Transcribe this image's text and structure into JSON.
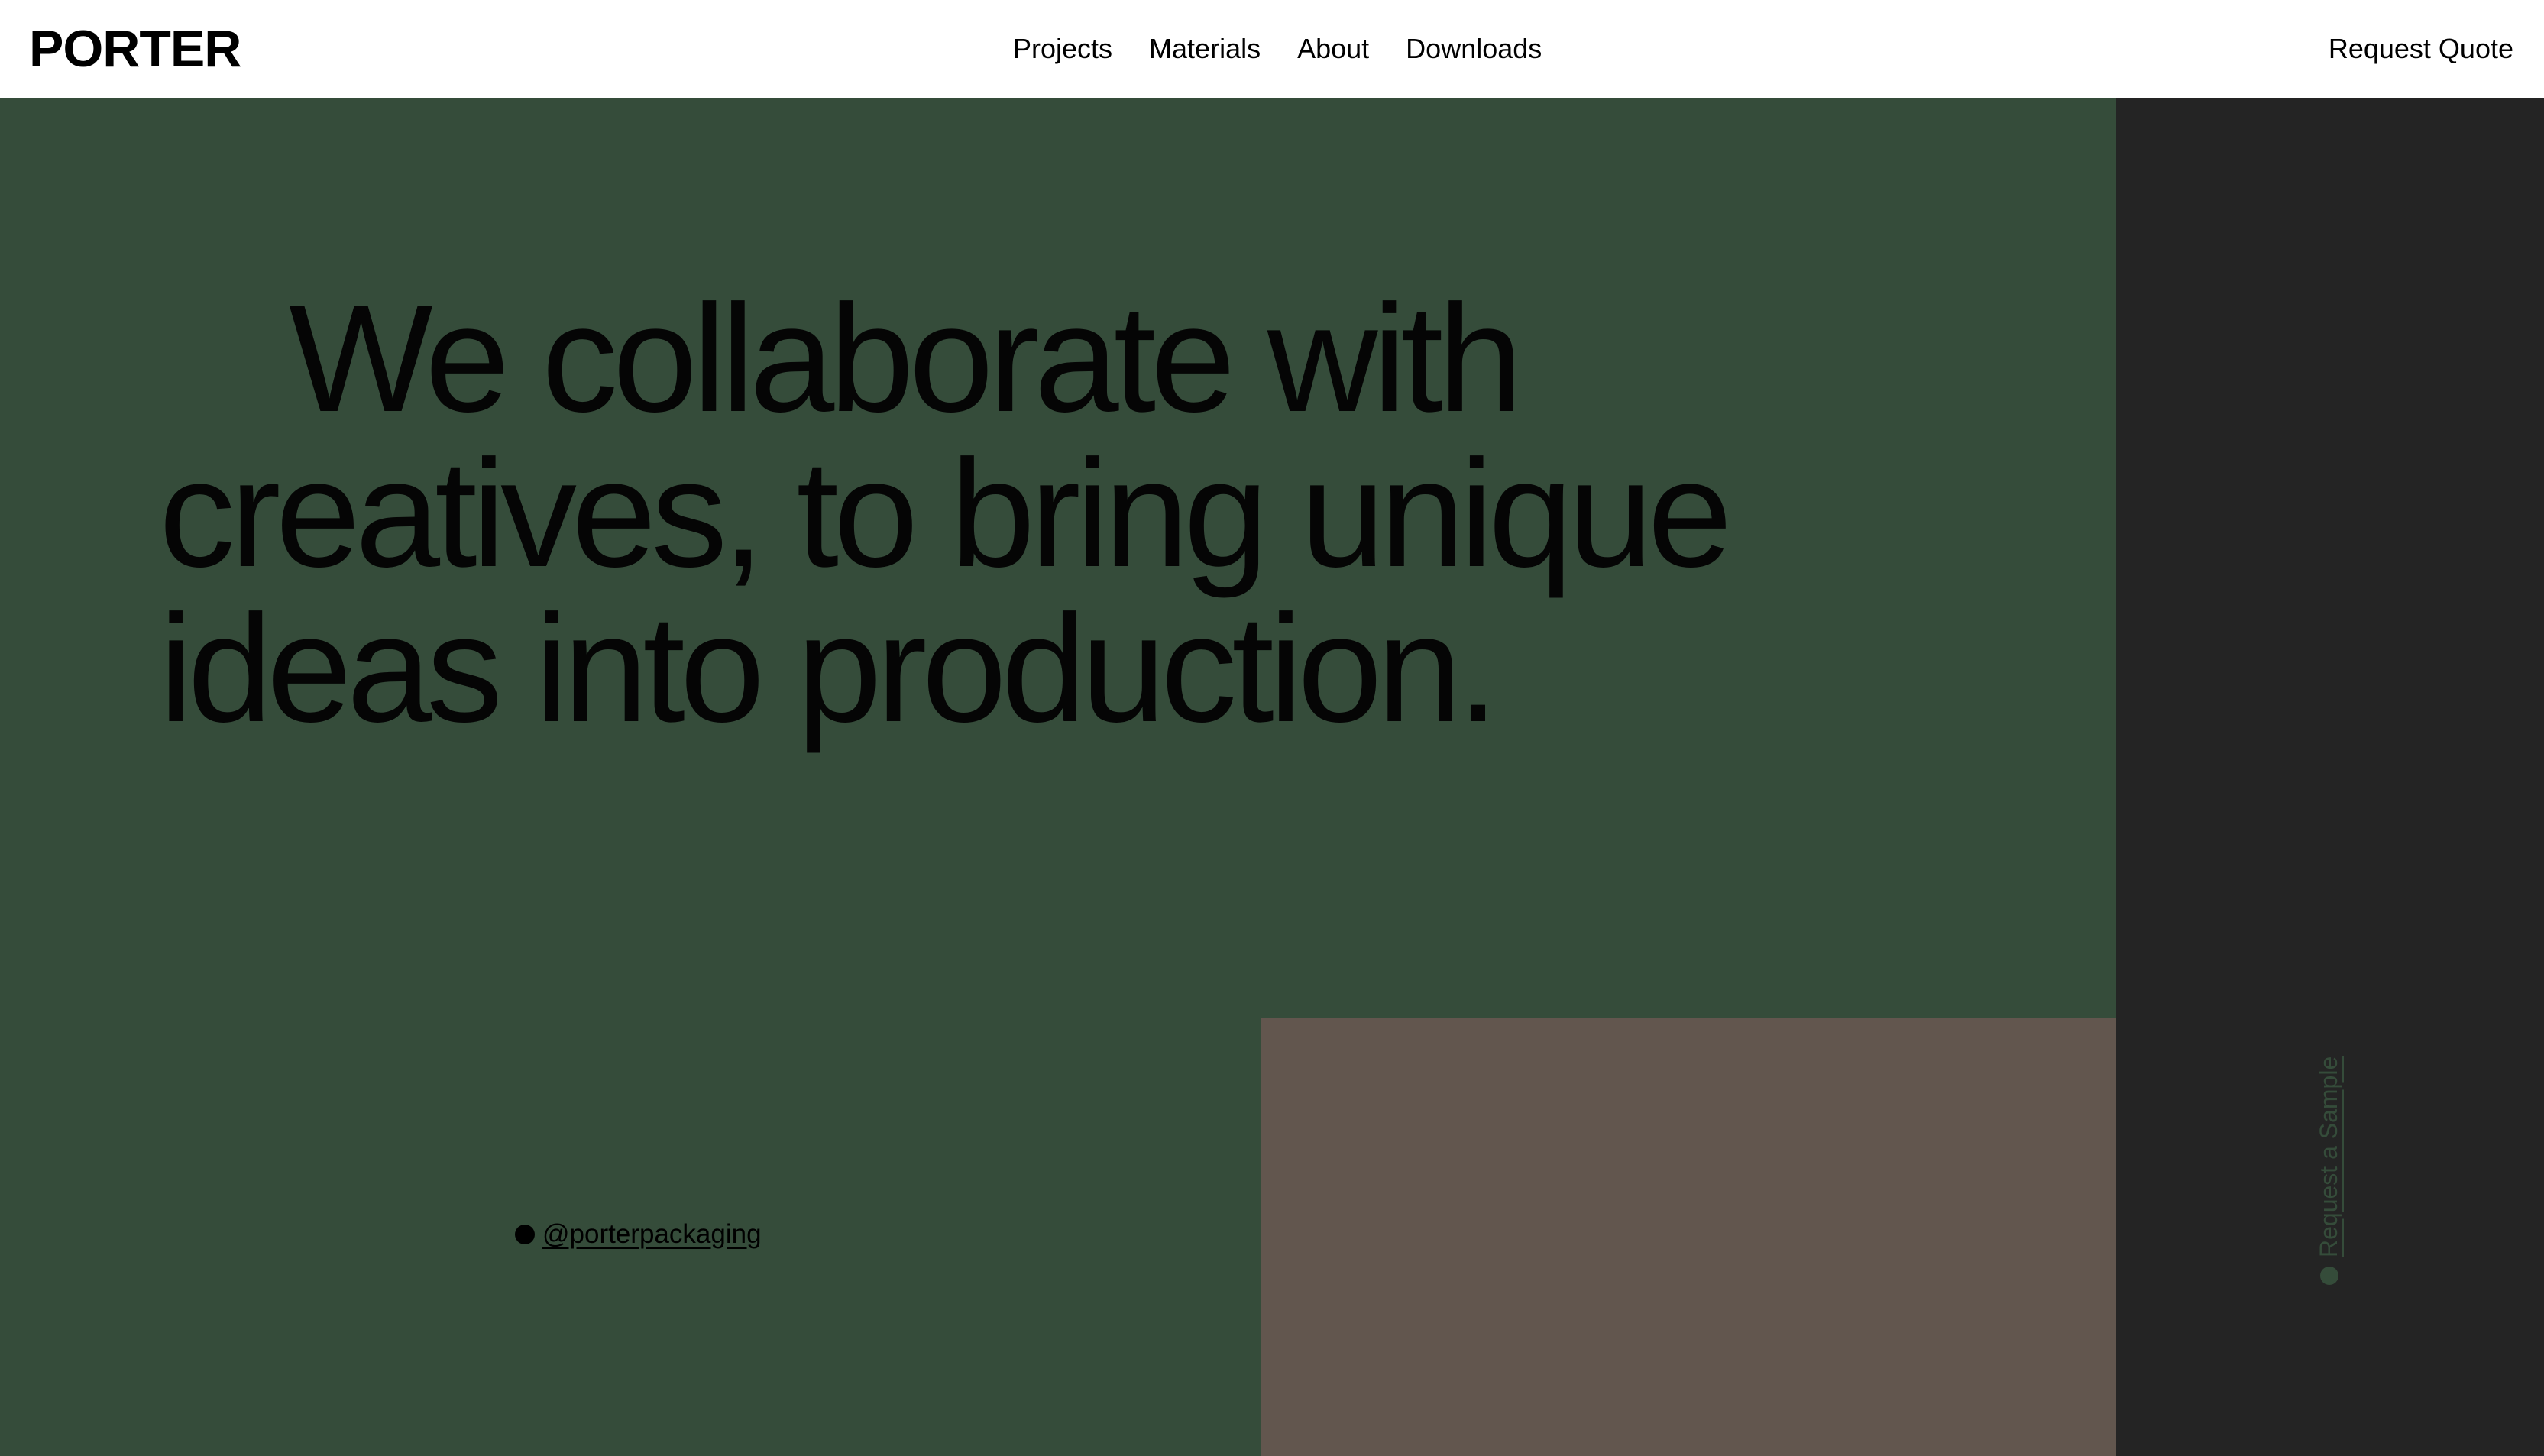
{
  "header": {
    "logo": "PORTER",
    "nav": [
      "Projects",
      "Materials",
      "About",
      "Downloads"
    ],
    "cta": "Request Quote"
  },
  "hero": {
    "headline": "We collaborate with creatives, to bring unique ideas into production.",
    "social_handle": "@porterpackaging"
  },
  "side_panel": {
    "link": "Request a Sample"
  },
  "colors": {
    "hero_background": "#354c3a",
    "side_panel_background": "#242424",
    "media_block": "#62564e",
    "header_background": "#ffffff",
    "text": "#000000"
  }
}
